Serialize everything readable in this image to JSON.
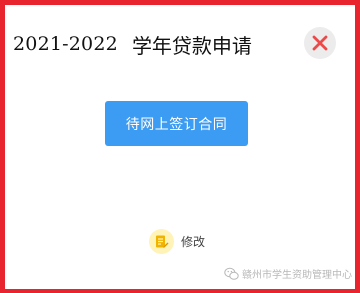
{
  "dialog": {
    "title_year": "2021-2022",
    "title_text": "学年贷款申请",
    "close_icon": "close-icon",
    "status_button_label": "待网上签订合同",
    "modify_label": "修改",
    "modify_icon": "edit-document-icon"
  },
  "watermark": {
    "text": "赣州市学生资助管理中心",
    "icon": "wechat-icon"
  },
  "colors": {
    "frame_border": "#e8242e",
    "close_x": "#ec4a4a",
    "close_bg": "#ececec",
    "primary_button": "#3c9cf3",
    "modify_icon_bg": "#fff3b8",
    "modify_icon_fg": "#f0b400"
  }
}
